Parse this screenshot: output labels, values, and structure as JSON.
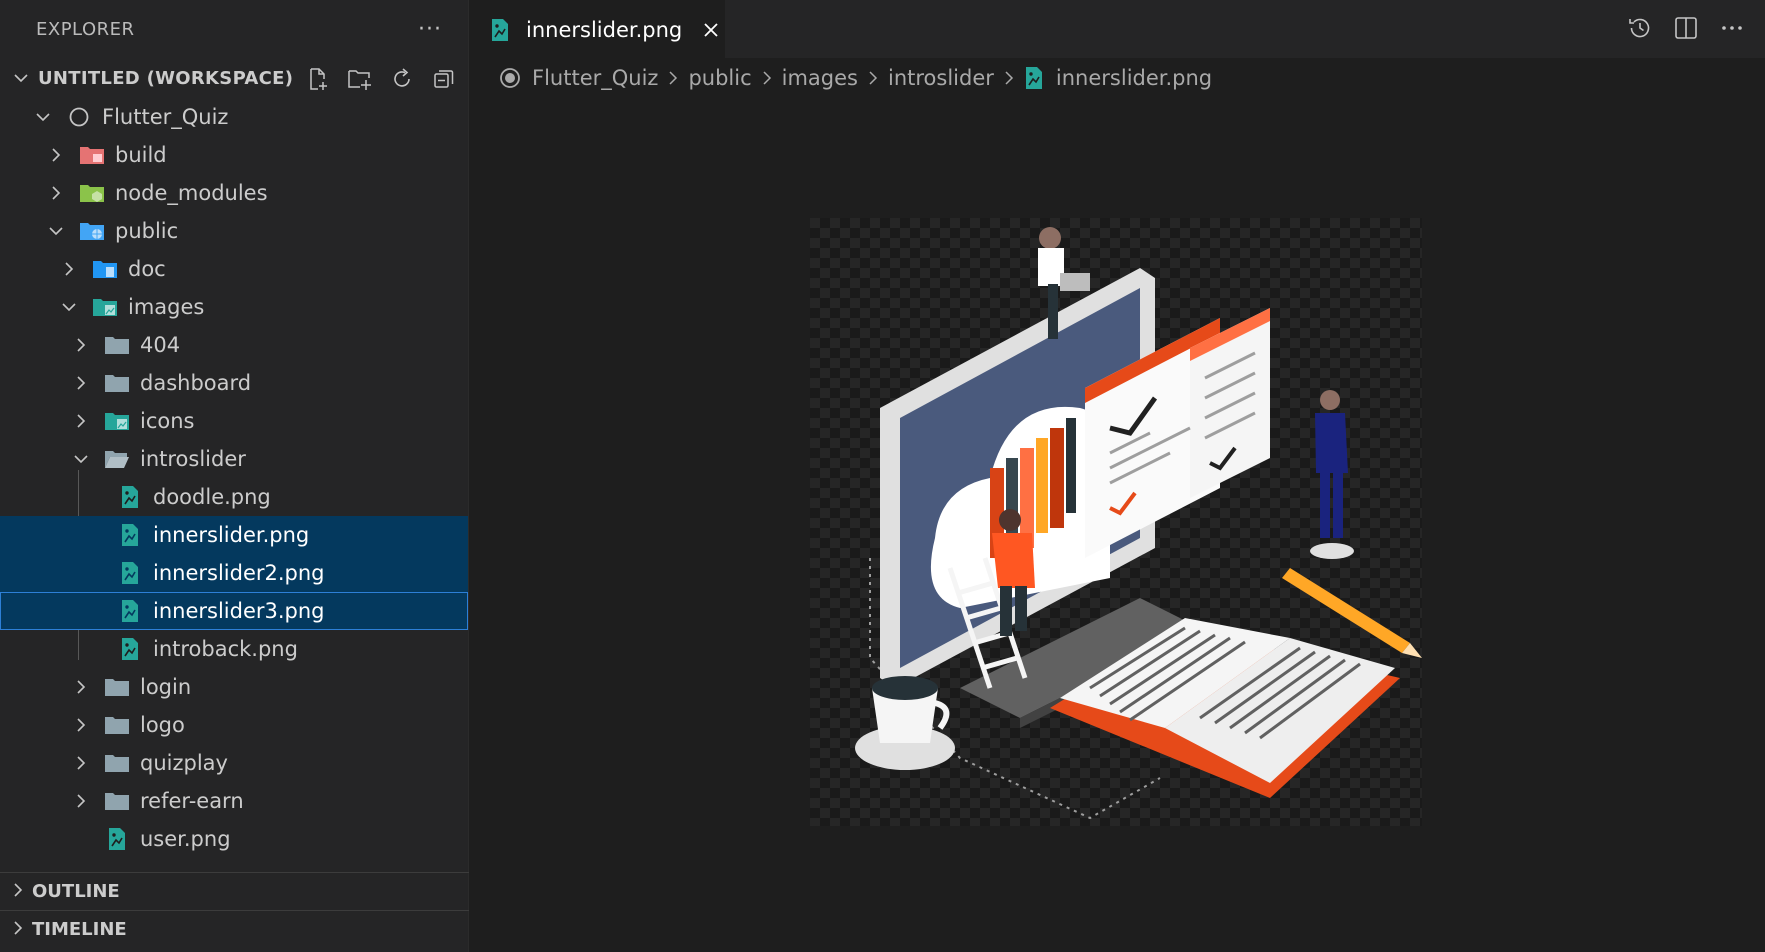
{
  "sidebar": {
    "title": "EXPLORER",
    "more": "···",
    "workspace": "UNTITLED (WORKSPACE)",
    "tree": [
      {
        "label": "Flutter_Quiz",
        "depth": 0,
        "expanded": true,
        "icon": "project-circle-icon"
      },
      {
        "label": "build",
        "depth": 1,
        "expanded": false,
        "icon": "folder-build-icon"
      },
      {
        "label": "node_modules",
        "depth": 1,
        "expanded": false,
        "icon": "folder-node-icon"
      },
      {
        "label": "public",
        "depth": 1,
        "expanded": true,
        "icon": "folder-public-icon"
      },
      {
        "label": "doc",
        "depth": 2,
        "expanded": false,
        "icon": "folder-doc-icon"
      },
      {
        "label": "images",
        "depth": 2,
        "expanded": true,
        "icon": "folder-images-icon"
      },
      {
        "label": "404",
        "depth": 3,
        "expanded": false,
        "icon": "folder-icon"
      },
      {
        "label": "dashboard",
        "depth": 3,
        "expanded": false,
        "icon": "folder-icon"
      },
      {
        "label": "icons",
        "depth": 3,
        "expanded": false,
        "icon": "folder-images-icon"
      },
      {
        "label": "introslider",
        "depth": 3,
        "expanded": true,
        "icon": "folder-open-icon"
      },
      {
        "label": "doodle.png",
        "depth": 4,
        "file": true,
        "icon": "image-file-icon"
      },
      {
        "label": "innerslider.png",
        "depth": 4,
        "file": true,
        "icon": "image-file-icon",
        "selected": true
      },
      {
        "label": "innerslider2.png",
        "depth": 4,
        "file": true,
        "icon": "image-file-icon",
        "selected": true
      },
      {
        "label": "innerslider3.png",
        "depth": 4,
        "file": true,
        "icon": "image-file-icon",
        "focused": true
      },
      {
        "label": "introback.png",
        "depth": 4,
        "file": true,
        "icon": "image-file-icon"
      },
      {
        "label": "login",
        "depth": 3,
        "expanded": false,
        "icon": "folder-icon"
      },
      {
        "label": "logo",
        "depth": 3,
        "expanded": false,
        "icon": "folder-icon"
      },
      {
        "label": "quizplay",
        "depth": 3,
        "expanded": false,
        "icon": "folder-icon"
      },
      {
        "label": "refer-earn",
        "depth": 3,
        "expanded": false,
        "icon": "folder-icon"
      },
      {
        "label": "user.png",
        "depth": 3,
        "file": true,
        "icon": "image-file-icon"
      }
    ],
    "outline": "OUTLINE",
    "timeline": "TIMELINE"
  },
  "editor": {
    "tab": {
      "label": "innerslider.png"
    },
    "breadcrumb": [
      "Flutter_Quiz",
      "public",
      "images",
      "introslider",
      "innerslider.png"
    ]
  },
  "colors": {
    "selection": "#04395e",
    "focus_border": "#2d7fd6",
    "image_icon": "#26a69a"
  }
}
